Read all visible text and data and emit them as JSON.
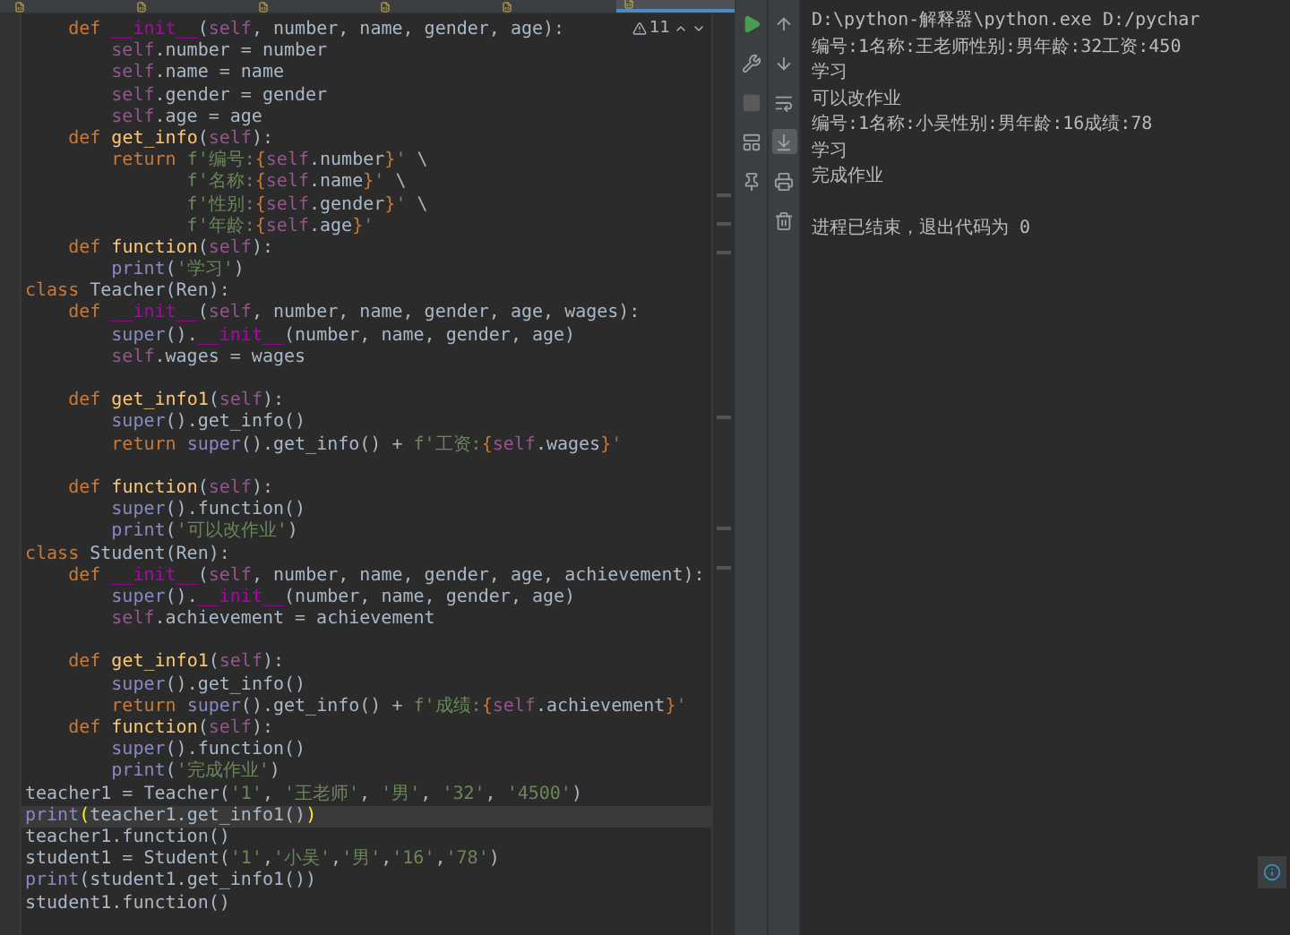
{
  "tabs": [
    {
      "selected": false
    },
    {
      "selected": false
    },
    {
      "selected": false
    },
    {
      "selected": false
    },
    {
      "selected": false
    },
    {
      "selected": true
    }
  ],
  "editor": {
    "warning_count": "11",
    "lines": [
      {
        "current": false,
        "tokens": [
          {
            "kind": "kw",
            "text": "    def "
          },
          {
            "kind": "magic",
            "text": "__init__"
          },
          {
            "kind": "p",
            "text": "("
          },
          {
            "kind": "self",
            "text": "self"
          },
          {
            "kind": "p",
            "text": ", number, name, gender, age):"
          }
        ]
      },
      {
        "current": false,
        "tokens": [
          {
            "kind": "self",
            "text": "        self"
          },
          {
            "kind": "p",
            "text": ".number = number"
          }
        ]
      },
      {
        "current": false,
        "tokens": [
          {
            "kind": "self",
            "text": "        self"
          },
          {
            "kind": "p",
            "text": ".name = name"
          }
        ]
      },
      {
        "current": false,
        "tokens": [
          {
            "kind": "self",
            "text": "        self"
          },
          {
            "kind": "p",
            "text": ".gender = gender"
          }
        ]
      },
      {
        "current": false,
        "tokens": [
          {
            "kind": "self",
            "text": "        self"
          },
          {
            "kind": "p",
            "text": ".age = age"
          }
        ]
      },
      {
        "current": false,
        "tokens": [
          {
            "kind": "kw",
            "text": "    def "
          },
          {
            "kind": "fn",
            "text": "get_info"
          },
          {
            "kind": "p",
            "text": "("
          },
          {
            "kind": "self",
            "text": "self"
          },
          {
            "kind": "p",
            "text": "):"
          }
        ]
      },
      {
        "current": false,
        "tokens": [
          {
            "kind": "kw",
            "text": "        return "
          },
          {
            "kind": "str",
            "text": "f'编号:"
          },
          {
            "kind": "brace",
            "text": "{"
          },
          {
            "kind": "self",
            "text": "self"
          },
          {
            "kind": "p",
            "text": ".number"
          },
          {
            "kind": "brace",
            "text": "}"
          },
          {
            "kind": "str",
            "text": "'"
          },
          {
            "kind": "p",
            "text": " \\"
          }
        ]
      },
      {
        "current": false,
        "tokens": [
          {
            "kind": "str",
            "text": "               f'名称:"
          },
          {
            "kind": "brace",
            "text": "{"
          },
          {
            "kind": "self",
            "text": "self"
          },
          {
            "kind": "p",
            "text": ".name"
          },
          {
            "kind": "brace",
            "text": "}"
          },
          {
            "kind": "str",
            "text": "'"
          },
          {
            "kind": "p",
            "text": " \\"
          }
        ]
      },
      {
        "current": false,
        "tokens": [
          {
            "kind": "str",
            "text": "               f'性别:"
          },
          {
            "kind": "brace",
            "text": "{"
          },
          {
            "kind": "self",
            "text": "self"
          },
          {
            "kind": "p",
            "text": ".gender"
          },
          {
            "kind": "brace",
            "text": "}"
          },
          {
            "kind": "str",
            "text": "'"
          },
          {
            "kind": "p",
            "text": " \\"
          }
        ]
      },
      {
        "current": false,
        "tokens": [
          {
            "kind": "str",
            "text": "               f'年龄:"
          },
          {
            "kind": "brace",
            "text": "{"
          },
          {
            "kind": "self",
            "text": "self"
          },
          {
            "kind": "p",
            "text": ".age"
          },
          {
            "kind": "brace",
            "text": "}"
          },
          {
            "kind": "str",
            "text": "'"
          }
        ]
      },
      {
        "current": false,
        "tokens": [
          {
            "kind": "kw",
            "text": "    def "
          },
          {
            "kind": "fn",
            "text": "function"
          },
          {
            "kind": "p",
            "text": "("
          },
          {
            "kind": "self",
            "text": "self"
          },
          {
            "kind": "p",
            "text": "):"
          }
        ]
      },
      {
        "current": false,
        "tokens": [
          {
            "kind": "builtin",
            "text": "        print"
          },
          {
            "kind": "p",
            "text": "("
          },
          {
            "kind": "str",
            "text": "'学习'"
          },
          {
            "kind": "p",
            "text": ")"
          }
        ]
      },
      {
        "current": false,
        "tokens": [
          {
            "kind": "kw",
            "text": "class "
          },
          {
            "kind": "p",
            "text": "Teacher(Ren):"
          }
        ]
      },
      {
        "current": false,
        "tokens": [
          {
            "kind": "kw",
            "text": "    def "
          },
          {
            "kind": "magic",
            "text": "__init__"
          },
          {
            "kind": "p",
            "text": "("
          },
          {
            "kind": "self",
            "text": "self"
          },
          {
            "kind": "p",
            "text": ", number, name, gender, age, wages):"
          }
        ]
      },
      {
        "current": false,
        "tokens": [
          {
            "kind": "builtin",
            "text": "        super"
          },
          {
            "kind": "p",
            "text": "()."
          },
          {
            "kind": "magic",
            "text": "__init__"
          },
          {
            "kind": "p",
            "text": "(number, name, gender, age)"
          }
        ]
      },
      {
        "current": false,
        "tokens": [
          {
            "kind": "self",
            "text": "        self"
          },
          {
            "kind": "p",
            "text": ".wages = wages"
          }
        ]
      },
      {
        "current": false
      },
      {
        "current": false,
        "tokens": [
          {
            "kind": "kw",
            "text": "    def "
          },
          {
            "kind": "fn",
            "text": "get_info1"
          },
          {
            "kind": "p",
            "text": "("
          },
          {
            "kind": "self",
            "text": "self"
          },
          {
            "kind": "p",
            "text": "):"
          }
        ]
      },
      {
        "current": false,
        "tokens": [
          {
            "kind": "builtin",
            "text": "        super"
          },
          {
            "kind": "p",
            "text": "().get_info()"
          }
        ]
      },
      {
        "current": false,
        "tokens": [
          {
            "kind": "kw",
            "text": "        return "
          },
          {
            "kind": "builtin",
            "text": "super"
          },
          {
            "kind": "p",
            "text": "().get_info() + "
          },
          {
            "kind": "str",
            "text": "f'工资:"
          },
          {
            "kind": "brace",
            "text": "{"
          },
          {
            "kind": "self",
            "text": "self"
          },
          {
            "kind": "p",
            "text": ".wages"
          },
          {
            "kind": "brace",
            "text": "}"
          },
          {
            "kind": "str",
            "text": "'"
          }
        ]
      },
      {
        "current": false
      },
      {
        "current": false,
        "tokens": [
          {
            "kind": "kw",
            "text": "    def "
          },
          {
            "kind": "fn",
            "text": "function"
          },
          {
            "kind": "p",
            "text": "("
          },
          {
            "kind": "self",
            "text": "self"
          },
          {
            "kind": "p",
            "text": "):"
          }
        ]
      },
      {
        "current": false,
        "tokens": [
          {
            "kind": "builtin",
            "text": "        super"
          },
          {
            "kind": "p",
            "text": "().function()"
          }
        ]
      },
      {
        "current": false,
        "tokens": [
          {
            "kind": "builtin",
            "text": "        print"
          },
          {
            "kind": "p",
            "text": "("
          },
          {
            "kind": "str",
            "text": "'可以改作业'"
          },
          {
            "kind": "p",
            "text": ")"
          }
        ]
      },
      {
        "current": false,
        "tokens": [
          {
            "kind": "kw",
            "text": "class "
          },
          {
            "kind": "p",
            "text": "Student(Ren):"
          }
        ]
      },
      {
        "current": false,
        "tokens": [
          {
            "kind": "kw",
            "text": "    def "
          },
          {
            "kind": "magic",
            "text": "__init__"
          },
          {
            "kind": "p",
            "text": "("
          },
          {
            "kind": "self",
            "text": "self"
          },
          {
            "kind": "p",
            "text": ", number, name, gender, age, achievement):"
          }
        ]
      },
      {
        "current": false,
        "tokens": [
          {
            "kind": "builtin",
            "text": "        super"
          },
          {
            "kind": "p",
            "text": "()."
          },
          {
            "kind": "magic",
            "text": "__init__"
          },
          {
            "kind": "p",
            "text": "(number, name, gender, age)"
          }
        ]
      },
      {
        "current": false,
        "tokens": [
          {
            "kind": "self",
            "text": "        self"
          },
          {
            "kind": "p",
            "text": ".achievement = achievement"
          }
        ]
      },
      {
        "current": false
      },
      {
        "current": false,
        "tokens": [
          {
            "kind": "kw",
            "text": "    def "
          },
          {
            "kind": "fn",
            "text": "get_info1"
          },
          {
            "kind": "p",
            "text": "("
          },
          {
            "kind": "self",
            "text": "self"
          },
          {
            "kind": "p",
            "text": "):"
          }
        ]
      },
      {
        "current": false,
        "tokens": [
          {
            "kind": "builtin",
            "text": "        super"
          },
          {
            "kind": "p",
            "text": "().get_info()"
          }
        ]
      },
      {
        "current": false,
        "tokens": [
          {
            "kind": "kw",
            "text": "        return "
          },
          {
            "kind": "builtin",
            "text": "super"
          },
          {
            "kind": "p",
            "text": "().get_info() + "
          },
          {
            "kind": "str",
            "text": "f'成绩:"
          },
          {
            "kind": "brace",
            "text": "{"
          },
          {
            "kind": "self",
            "text": "self"
          },
          {
            "kind": "p",
            "text": ".achievement"
          },
          {
            "kind": "brace",
            "text": "}"
          },
          {
            "kind": "str",
            "text": "'"
          }
        ]
      },
      {
        "current": false,
        "tokens": [
          {
            "kind": "kw",
            "text": "    def "
          },
          {
            "kind": "fn",
            "text": "function"
          },
          {
            "kind": "p",
            "text": "("
          },
          {
            "kind": "self",
            "text": "self"
          },
          {
            "kind": "p",
            "text": "):"
          }
        ]
      },
      {
        "current": false,
        "tokens": [
          {
            "kind": "builtin",
            "text": "        super"
          },
          {
            "kind": "p",
            "text": "().function()"
          }
        ]
      },
      {
        "current": false,
        "tokens": [
          {
            "kind": "builtin",
            "text": "        print"
          },
          {
            "kind": "p",
            "text": "("
          },
          {
            "kind": "str",
            "text": "'完成作业'"
          },
          {
            "kind": "p",
            "text": ")"
          }
        ]
      },
      {
        "current": false,
        "tokens": [
          {
            "kind": "p",
            "text": "teacher1 = Teacher("
          },
          {
            "kind": "str",
            "text": "'1'"
          },
          {
            "kind": "p",
            "text": ", "
          },
          {
            "kind": "str",
            "text": "'王老师'"
          },
          {
            "kind": "p",
            "text": ", "
          },
          {
            "kind": "str",
            "text": "'男'"
          },
          {
            "kind": "p",
            "text": ", "
          },
          {
            "kind": "str",
            "text": "'32'"
          },
          {
            "kind": "p",
            "text": ", "
          },
          {
            "kind": "str",
            "text": "'4500'"
          },
          {
            "kind": "p",
            "text": ")"
          }
        ]
      },
      {
        "current": true,
        "tokens": [
          {
            "kind": "builtin",
            "text": "print"
          },
          {
            "kind": "match",
            "text": "("
          },
          {
            "kind": "p",
            "text": "teacher1.get_info1()"
          },
          {
            "kind": "match",
            "text": ")"
          }
        ]
      },
      {
        "current": false,
        "tokens": [
          {
            "kind": "p",
            "text": "teacher1.function()"
          }
        ]
      },
      {
        "current": false,
        "tokens": [
          {
            "kind": "p",
            "text": "student1 = Student("
          },
          {
            "kind": "str",
            "text": "'1'"
          },
          {
            "kind": "p",
            "text": ","
          },
          {
            "kind": "str",
            "text": "'小吴'"
          },
          {
            "kind": "p",
            "text": ","
          },
          {
            "kind": "str",
            "text": "'男'"
          },
          {
            "kind": "p",
            "text": ","
          },
          {
            "kind": "str",
            "text": "'16'"
          },
          {
            "kind": "p",
            "text": ","
          },
          {
            "kind": "str",
            "text": "'78'"
          },
          {
            "kind": "p",
            "text": ")"
          }
        ]
      },
      {
        "current": false,
        "tokens": [
          {
            "kind": "builtin",
            "text": "print"
          },
          {
            "kind": "p",
            "text": "(student1.get_info1())"
          }
        ]
      },
      {
        "current": false,
        "tokens": [
          {
            "kind": "p",
            "text": "student1.function()"
          }
        ]
      }
    ]
  },
  "run_tools": [
    {
      "kind": "run"
    },
    {
      "kind": "wrench"
    },
    {
      "kind": "stop"
    },
    {
      "kind": "layout"
    },
    {
      "kind": "pin"
    }
  ],
  "output_tools": [
    {
      "kind": "up",
      "on": false
    },
    {
      "kind": "down",
      "on": false
    },
    {
      "kind": "wrap",
      "on": false
    },
    {
      "kind": "scroll-end",
      "on": true
    },
    {
      "kind": "print",
      "on": false
    },
    {
      "kind": "trash",
      "on": false
    }
  ],
  "output": [
    "D:\\python-解释器\\python.exe D:/pychar",
    "编号:1名称:王老师性别:男年龄:32工资:450",
    "学习",
    "可以改作业",
    "编号:1名称:小吴性别:男年龄:16成绩:78",
    "学习",
    "完成作业"
  ],
  "exit_message": "进程已结束，退出代码为 0"
}
